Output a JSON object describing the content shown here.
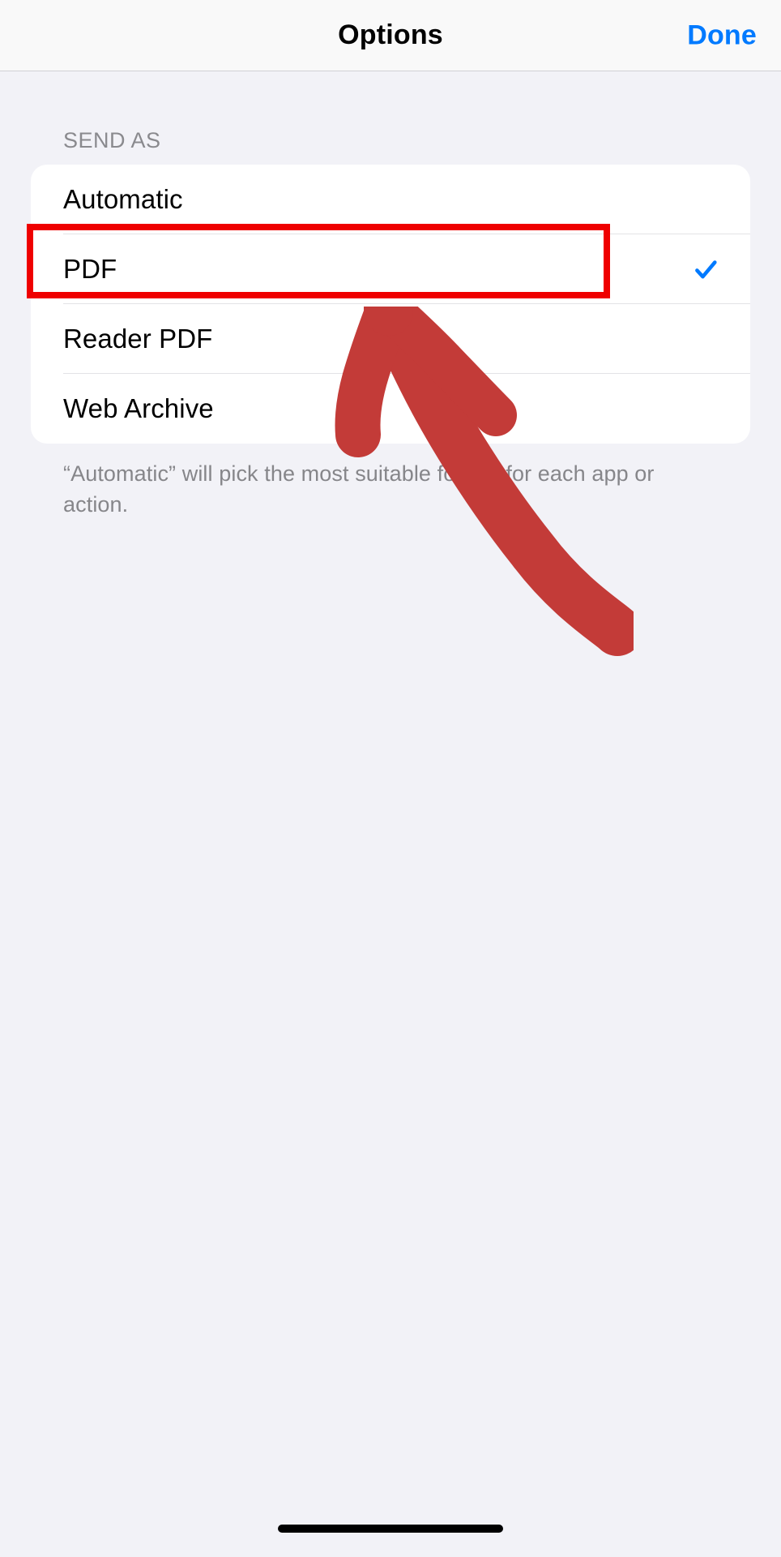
{
  "header": {
    "title": "Options",
    "done_label": "Done"
  },
  "send_as": {
    "section_header": "SEND AS",
    "options": [
      {
        "label": "Automatic",
        "selected": false
      },
      {
        "label": "PDF",
        "selected": true
      },
      {
        "label": "Reader PDF",
        "selected": false
      },
      {
        "label": "Web Archive",
        "selected": false
      }
    ],
    "footer": "“Automatic” will pick the most suitable format for each app or action."
  },
  "annotation": {
    "highlight_index": 1,
    "arrow_color": "#c33b38",
    "highlight_color": "#ef0000"
  }
}
